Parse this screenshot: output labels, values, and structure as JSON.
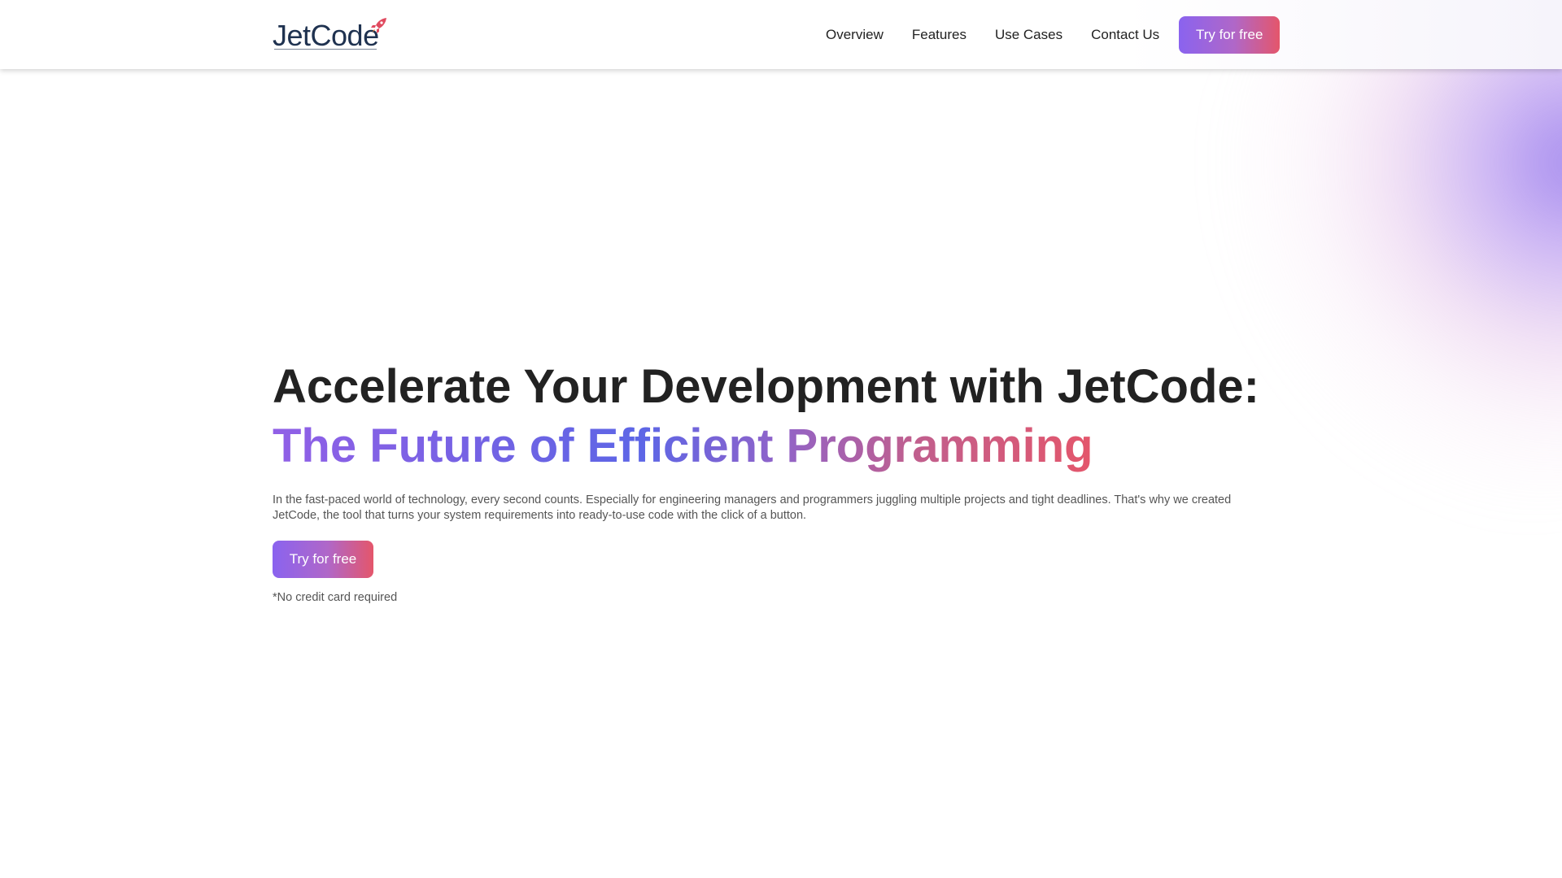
{
  "header": {
    "logo_text": "JetCode",
    "logo_icon": "rocket-icon",
    "nav": [
      "Overview",
      "Features",
      "Use Cases",
      "Contact Us"
    ],
    "cta_label": "Try for free"
  },
  "hero": {
    "title": "Accelerate Your Development with JetCode:",
    "subtitle": "The Future of Efficient Programming",
    "description": "In the fast-paced world of technology, every second counts. Especially for engineering managers and programmers juggling multiple projects and tight deadlines. That's why we created JetCode, the tool that turns your system requirements into ready-to-use code with the click of a button.",
    "cta_label": "Try for free",
    "note": "*No credit card required"
  },
  "colors": {
    "gradient_start": "#8a63ef",
    "gradient_end": "#e4566b",
    "logo_navy": "#1f3250",
    "text_dark": "#222222",
    "text_muted": "#555555"
  }
}
